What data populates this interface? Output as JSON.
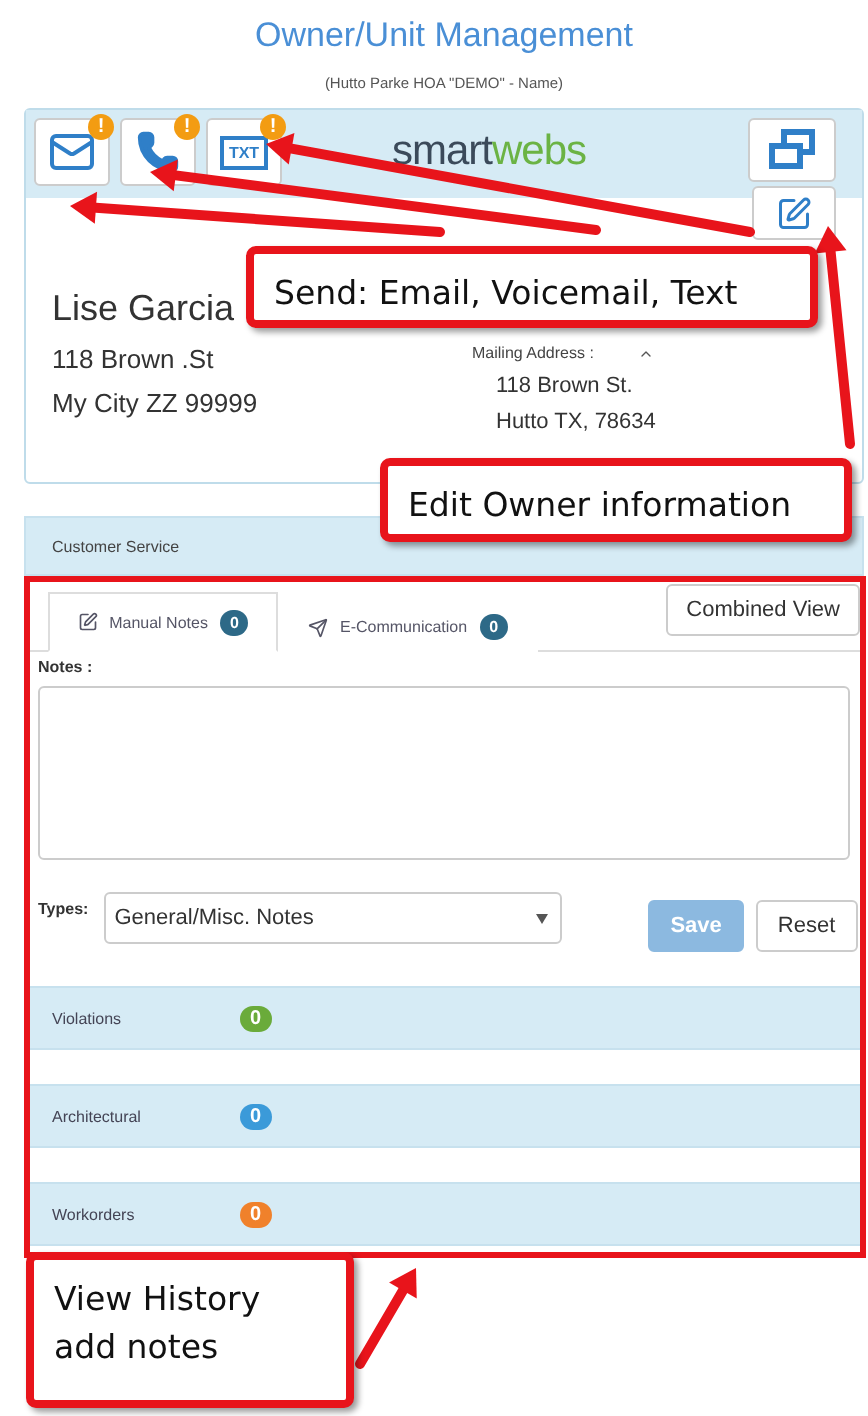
{
  "page": {
    "title": "Owner/Unit Management",
    "subtitle": "(Hutto Parke HOA \"DEMO\" - Name)"
  },
  "toolbar": {
    "buttons": [
      {
        "kind": "email",
        "alert": "!"
      },
      {
        "kind": "phone",
        "alert": "!"
      },
      {
        "kind": "text",
        "label": "TXT",
        "alert": "!"
      }
    ],
    "logo": {
      "first": "smart",
      "second": "webs"
    }
  },
  "owner": {
    "name": "Lise Garcia",
    "address": [
      "118 Brown .St",
      "My City ZZ 99999"
    ],
    "mailing_label": "Mailing Address :",
    "mailing": [
      "118 Brown St.",
      "Hutto TX, 78634"
    ]
  },
  "section": {
    "title": "Customer Service"
  },
  "tabs": [
    {
      "label": "Manual Notes",
      "count": "0",
      "selected": true,
      "kind": "notes"
    },
    {
      "label": "E-Communication",
      "count": "0",
      "selected": false,
      "kind": "send"
    }
  ],
  "combined_view": "Combined View",
  "notes": {
    "label": "Notes :",
    "types_label": "Types:",
    "type_value": "General/Misc. Notes",
    "save": {
      "label": "Save",
      "disabled": true
    },
    "reset": "Reset"
  },
  "history": [
    {
      "label": "Violations",
      "count": "0",
      "color": "#6aab3a"
    },
    {
      "label": "Architectural",
      "count": "0",
      "color": "#3b9ad9"
    },
    {
      "label": "Workorders",
      "count": "0",
      "color": "#f0812b"
    }
  ],
  "annotations": [
    {
      "text": "Send: Email, Voicemail, Text"
    },
    {
      "text": "Edit Owner information"
    },
    {
      "text": "View History\nadd notes"
    }
  ]
}
